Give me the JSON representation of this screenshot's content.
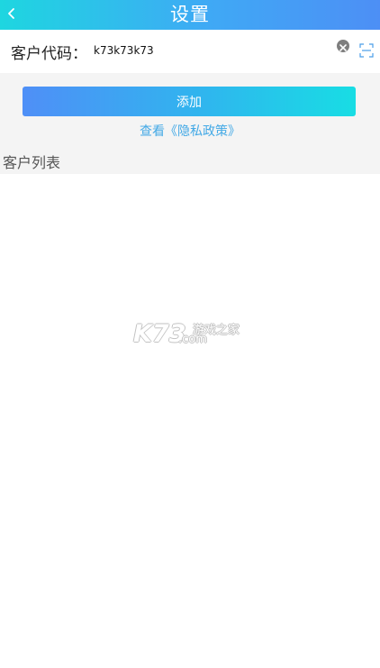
{
  "header": {
    "title": "设置",
    "back_icon": "chevron-left-icon"
  },
  "form": {
    "label": "客户代码：",
    "input_value": "k73k73k73",
    "clear_icon": "clear-icon",
    "scan_icon": "scan-icon"
  },
  "actions": {
    "add_label": "添加",
    "privacy_link": "查看《隐私政策》"
  },
  "list": {
    "section_title": "客户列表",
    "items": []
  },
  "watermark": {
    "logo": "K73",
    "cn_text": "游戏之家",
    "domain": ".com"
  },
  "colors": {
    "header_gradient_start": "#1ed6e0",
    "header_gradient_end": "#4d8ff5",
    "button_gradient_start": "#4f8ff7",
    "button_gradient_end": "#18dde4",
    "link": "#43a9e6",
    "background_gray": "#f4f4f4"
  }
}
